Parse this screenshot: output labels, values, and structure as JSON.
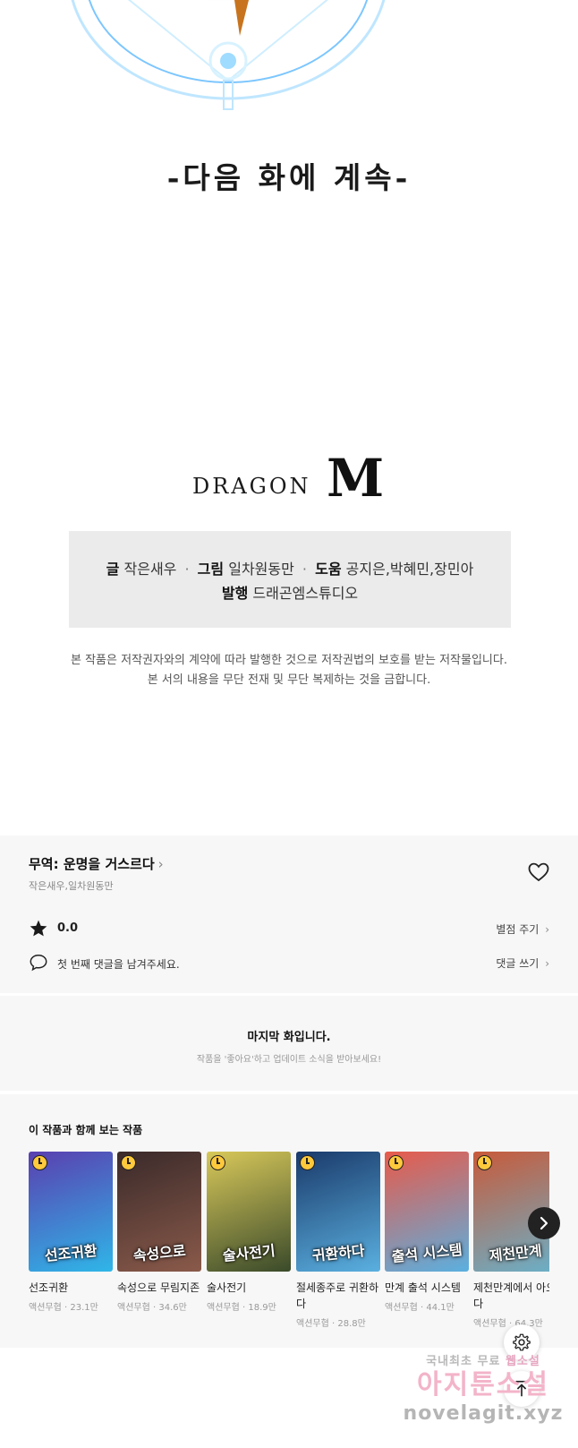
{
  "episode_end": {
    "to_be_continued": "-다음 화에 계속-"
  },
  "publisher_logo": {
    "text": "DRAGON",
    "mark": "M"
  },
  "credits": {
    "line1": [
      {
        "role": "글",
        "name": "작은새우"
      },
      {
        "role": "그림",
        "name": "일차원동만"
      },
      {
        "role": "도움",
        "name": "공지은,박혜민,장민아"
      }
    ],
    "line2": {
      "role": "발행",
      "name": "드래곤엠스튜디오"
    },
    "separator": "·"
  },
  "copyright": {
    "line1": "본 작품은 저작권자와의 계약에 따라 발행한 것으로 저작권법의 보호를 받는 저작물입니다.",
    "line2": "본 서의 내용을 무단 전재 및 무단 복제하는 것을 금합니다."
  },
  "work_info": {
    "title": "무역: 운명을 거스르다",
    "title_chevron": "›",
    "authors": "작은새우,일차원동만",
    "rating": "0.0",
    "rate_link": "별점 주기",
    "comment_prompt": "첫 번째 댓글을 남겨주세요.",
    "comment_link": "댓글 쓰기",
    "link_chevron": "›",
    "icons": {
      "favorite": "heart-icon",
      "rating": "star-icon",
      "comment": "speech-bubble-icon"
    }
  },
  "last_episode": {
    "title": "마지막 화입니다.",
    "subtitle": "작품을 '좋아요'하고 업데이트 소식을 받아보세요!"
  },
  "recommendations": {
    "heading": "이 작품과 함께 보는 작품",
    "items": [
      {
        "name": "선조귀환",
        "genre": "액션무협",
        "views": "23.1만",
        "cover_title": "선조귀환",
        "colors": [
          "#5a3fb0",
          "#2fb6e8"
        ]
      },
      {
        "name": "속성으로 무림지존",
        "genre": "액션무협",
        "views": "34.6만",
        "cover_title": "속성으로",
        "colors": [
          "#3a2a2a",
          "#8a5a4a"
        ]
      },
      {
        "name": "술사전기",
        "genre": "액션무협",
        "views": "18.9만",
        "cover_title": "술사전기",
        "colors": [
          "#d8c85a",
          "#3a4a2a"
        ]
      },
      {
        "name": "절세종주로 귀환하다",
        "genre": "액션무협",
        "views": "28.8만",
        "cover_title": "귀환하다",
        "colors": [
          "#1a3a6a",
          "#5ab0e0"
        ]
      },
      {
        "name": "만계 출석 시스템",
        "genre": "액션무협",
        "views": "44.1만",
        "cover_title": "출석 시스템",
        "colors": [
          "#e85a4a",
          "#5ab0e0"
        ]
      },
      {
        "name": "제천만계에서 아오다",
        "genre": "액션무협",
        "views": "64.3만",
        "cover_title": "제천만계",
        "colors": [
          "#c85a3a",
          "#6ab0c8"
        ]
      }
    ],
    "meta_separator": "·"
  },
  "floating": {
    "settings": "gear-icon",
    "scroll_top": "arrow-up-to-line-icon"
  },
  "watermark": {
    "line1_a": "국내최초 무료",
    "line1_b": "웹소설",
    "line2": "아지툰소설",
    "line3": "novelagit.xyz"
  }
}
